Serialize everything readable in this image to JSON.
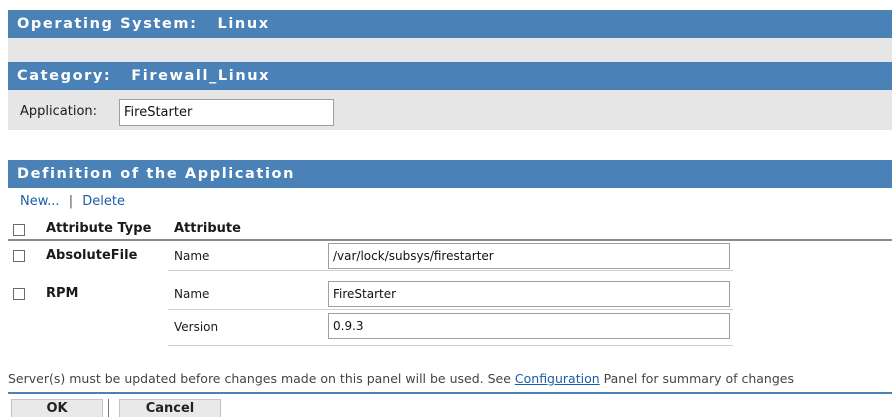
{
  "os_header": {
    "label": "Operating System:",
    "value": "Linux"
  },
  "category_header": {
    "label": "Category:",
    "value": "Firewall_Linux"
  },
  "application": {
    "label": "Application:",
    "value": "FireStarter"
  },
  "definition": {
    "title": "Definition of the Application",
    "actions": {
      "new": "New...",
      "separator": "|",
      "delete": "Delete"
    },
    "columns": {
      "type": "Attribute Type",
      "attribute": "Attribute"
    },
    "rows": [
      {
        "type": "AbsoluteFile",
        "attrs": [
          {
            "name": "Name",
            "value": "/var/lock/subsys/firestarter"
          }
        ]
      },
      {
        "type": "RPM",
        "attrs": [
          {
            "name": "Name",
            "value": "FireStarter"
          },
          {
            "name": "Version",
            "value": "0.9.3"
          }
        ]
      }
    ]
  },
  "notice": {
    "before": "Server(s) must be updated before changes made on this panel will be used. See ",
    "link": "Configuration",
    "after": " Panel for summary of changes"
  },
  "buttons": {
    "ok": "OK",
    "cancel": "Cancel"
  },
  "colors": {
    "header_bar": "#4a82b8",
    "link": "#1a5ea7",
    "band": "#e6e6e6"
  }
}
